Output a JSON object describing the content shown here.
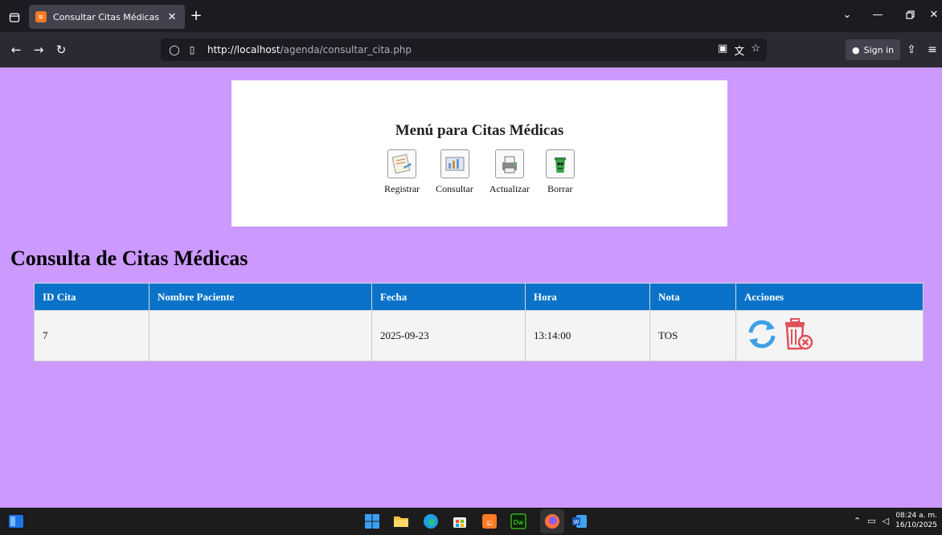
{
  "browser": {
    "tab_title": "Consultar Citas Médicas",
    "tab_favicon": "xampp-icon",
    "url_host": "http://localhost",
    "url_path": "/agenda/consultar_cita.php",
    "sign_in_label": "Sign in"
  },
  "page": {
    "menu_title": "Menú para Citas Médicas",
    "menu_items": [
      {
        "label": "Registrar",
        "icon": "register-icon"
      },
      {
        "label": "Consultar",
        "icon": "consult-icon"
      },
      {
        "label": "Actualizar",
        "icon": "update-icon"
      },
      {
        "label": "Borrar",
        "icon": "delete-icon"
      }
    ],
    "heading": "Consulta de Citas Médicas",
    "table": {
      "headers": [
        "ID Cita",
        "Nombre Paciente",
        "Fecha",
        "Hora",
        "Nota",
        "Acciones"
      ],
      "rows": [
        {
          "id": "7",
          "nombre": "",
          "fecha": "2025-09-23",
          "hora": "13:14:00",
          "nota": "TOS"
        }
      ]
    },
    "colors": {
      "background": "#cc99ff",
      "header_bg": "#0a73c9",
      "refresh_icon": "#3ea0e6",
      "trash_icon": "#e0505a"
    }
  },
  "taskbar": {
    "time": "08:24 a. m.",
    "date": "16/10/2025"
  }
}
